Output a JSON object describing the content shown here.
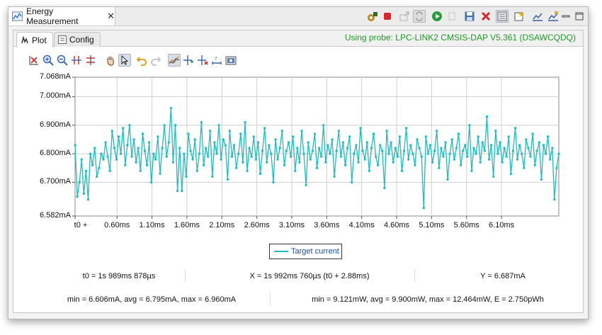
{
  "view": {
    "title": "Energy Measurement"
  },
  "tabs": [
    "Plot",
    "Config"
  ],
  "probe_status": "Using probe: LPC-LINK2 CMSIS-DAP V5.361 (DSAWCQDQ)",
  "toolbar_icons": [
    "probe-config-icon",
    "stop-icon",
    "export-icon",
    "refresh-icon",
    "run-icon",
    "pause-icon",
    "save-icon",
    "delete-icon",
    "layout-icon",
    "new-view-icon",
    "chart-icon",
    "chart-edit-icon",
    "minimize-icon",
    "maximize-icon"
  ],
  "plot_toolbar_icons": [
    "axis-icon",
    "zoom-in-icon",
    "zoom-out-icon",
    "fit-horizontal-icon",
    "fit-vertical-icon",
    "pan-icon",
    "select-icon",
    "undo-icon",
    "redo-icon",
    "trace-icon",
    "add-marker-icon",
    "remove-marker-icon",
    "measure-icon",
    "camera-icon"
  ],
  "colors": {
    "series": "#1dbdbd",
    "probe_text": "#1f9a25",
    "grid": "#cfcfcf"
  },
  "chart_data": {
    "type": "line",
    "series": [
      {
        "name": "Target current",
        "unit": "mA"
      }
    ],
    "y_ticks": [
      "7.068mA",
      "7.000mA",
      "6.900mA",
      "6.800mA",
      "6.700mA",
      "6.582mA"
    ],
    "y_tick_values": [
      7.068,
      7.0,
      6.9,
      6.8,
      6.7,
      6.582
    ],
    "ylim": [
      6.582,
      7.068
    ],
    "x_ticks": [
      "t0 +",
      "0.60ms",
      "1.10ms",
      "1.60ms",
      "2.10ms",
      "2.60ms",
      "3.10ms",
      "3.60ms",
      "4.10ms",
      "4.60ms",
      "5.10ms",
      "5.60ms",
      "6.10ms"
    ],
    "x_tick_values": [
      0.0,
      0.6,
      1.1,
      1.6,
      2.1,
      2.6,
      3.1,
      3.6,
      4.1,
      4.6,
      5.1,
      5.6,
      6.1
    ],
    "xlim": [
      0.0,
      6.92
    ],
    "y_values": [
      6.83,
      6.65,
      6.7,
      6.78,
      6.66,
      6.74,
      6.64,
      6.8,
      6.76,
      6.82,
      6.72,
      6.75,
      6.8,
      6.78,
      6.84,
      6.79,
      6.74,
      6.88,
      6.82,
      6.78,
      6.86,
      6.8,
      6.89,
      6.76,
      6.83,
      6.9,
      6.79,
      6.85,
      6.77,
      6.82,
      6.74,
      6.87,
      6.81,
      6.76,
      6.84,
      6.7,
      6.8,
      6.78,
      6.86,
      6.73,
      6.82,
      6.9,
      6.79,
      6.84,
      6.96,
      6.77,
      6.9,
      6.67,
      6.82,
      6.67,
      6.8,
      6.72,
      6.87,
      6.81,
      6.78,
      6.85,
      6.74,
      6.8,
      6.91,
      6.76,
      6.82,
      6.79,
      6.88,
      6.72,
      6.84,
      6.8,
      6.9,
      6.78,
      6.85,
      6.83,
      6.71,
      6.88,
      6.79,
      6.83,
      6.75,
      6.8,
      6.87,
      6.77,
      6.91,
      6.74,
      6.82,
      6.79,
      6.86,
      6.78,
      6.84,
      6.73,
      6.81,
      6.89,
      6.77,
      6.83,
      6.8,
      6.7,
      6.85,
      6.78,
      6.82,
      6.88,
      6.76,
      6.81,
      6.84,
      6.79,
      6.86,
      6.74,
      6.82,
      6.77,
      6.88,
      6.8,
      6.69,
      6.84,
      6.78,
      6.81,
      6.87,
      6.75,
      6.82,
      6.79,
      6.9,
      6.77,
      6.83,
      6.8,
      6.85,
      6.72,
      6.81,
      6.88,
      6.79,
      6.84,
      6.76,
      6.82,
      6.86,
      6.7,
      6.8,
      6.83,
      6.77,
      6.89,
      6.81,
      6.78,
      6.84,
      6.74,
      6.82,
      6.87,
      6.79,
      6.76,
      6.83,
      6.81,
      6.68,
      6.88,
      6.8,
      6.84,
      6.77,
      6.82,
      6.79,
      6.86,
      6.74,
      6.81,
      6.89,
      6.78,
      6.83,
      6.8,
      6.76,
      6.85,
      6.82,
      6.79,
      6.61,
      6.86,
      6.8,
      6.83,
      6.77,
      6.81,
      6.88,
      6.75,
      6.82,
      6.79,
      6.84,
      6.71,
      6.8,
      6.85,
      6.78,
      6.82,
      6.87,
      6.76,
      6.81,
      6.83,
      6.79,
      6.9,
      6.74,
      6.82,
      6.8,
      6.86,
      6.77,
      6.84,
      6.81,
      6.93,
      6.78,
      6.83,
      6.72,
      6.88,
      6.8,
      6.84,
      6.77,
      6.82,
      6.79,
      6.86,
      6.73,
      6.81,
      6.89,
      6.78,
      6.83,
      6.8,
      6.75,
      6.85,
      6.82,
      6.79,
      6.87,
      6.76,
      6.81,
      6.84,
      6.71,
      6.83,
      6.8,
      6.86,
      6.78,
      6.82,
      6.64,
      6.75,
      6.8
    ]
  },
  "legend_label": "Target current",
  "stats": {
    "t0": "t0 = 1s 989ms 878µs",
    "x": "X = 1s 992ms 760µs (t0 + 2.88ms)",
    "y": "Y = 6.687mA",
    "current": "min = 6.606mA, avg = 6.795mA, max = 6.960mA",
    "power": "min = 9.121mW, avg = 9.900mW, max = 12.464mW, E = 2.750pWh"
  }
}
